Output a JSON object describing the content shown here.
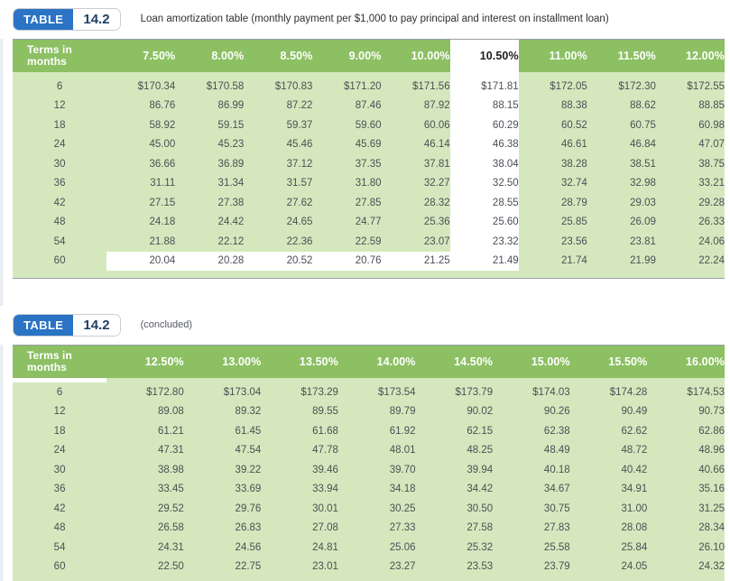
{
  "tables": [
    {
      "badge_label": "TABLE",
      "badge_number": "14.2",
      "caption": "Loan amortization table (monthly payment per $1,000 to pay principal and interest on installment loan)",
      "terms_header": "Terms in\nmonths",
      "columns": [
        "7.50%",
        "8.00%",
        "8.50%",
        "9.00%",
        "10.00%",
        "10.50%",
        "11.00%",
        "11.50%",
        "12.00%"
      ],
      "highlight_column_index": 5,
      "highlight_row_index": 9,
      "highlight_row_from_col": 0,
      "highlight_row_to_col": 5,
      "rows": [
        {
          "term": "6",
          "values": [
            "$170.34",
            "$170.58",
            "$170.83",
            "$171.20",
            "$171.56",
            "$171.81",
            "$172.05",
            "$172.30",
            "$172.55"
          ]
        },
        {
          "term": "12",
          "values": [
            "86.76",
            "86.99",
            "87.22",
            "87.46",
            "87.92",
            "88.15",
            "88.38",
            "88.62",
            "88.85"
          ]
        },
        {
          "term": "18",
          "values": [
            "58.92",
            "59.15",
            "59.37",
            "59.60",
            "60.06",
            "60.29",
            "60.52",
            "60.75",
            "60.98"
          ]
        },
        {
          "term": "24",
          "values": [
            "45.00",
            "45.23",
            "45.46",
            "45.69",
            "46.14",
            "46.38",
            "46.61",
            "46.84",
            "47.07"
          ]
        },
        {
          "term": "30",
          "values": [
            "36.66",
            "36.89",
            "37.12",
            "37.35",
            "37.81",
            "38.04",
            "38.28",
            "38.51",
            "38.75"
          ]
        },
        {
          "term": "36",
          "values": [
            "31.11",
            "31.34",
            "31.57",
            "31.80",
            "32.27",
            "32.50",
            "32.74",
            "32.98",
            "33.21"
          ]
        },
        {
          "term": "42",
          "values": [
            "27.15",
            "27.38",
            "27.62",
            "27.85",
            "28.32",
            "28.55",
            "28.79",
            "29.03",
            "29.28"
          ]
        },
        {
          "term": "48",
          "values": [
            "24.18",
            "24.42",
            "24.65",
            "24.77",
            "25.36",
            "25.60",
            "25.85",
            "26.09",
            "26.33"
          ]
        },
        {
          "term": "54",
          "values": [
            "21.88",
            "22.12",
            "22.36",
            "22.59",
            "23.07",
            "23.32",
            "23.56",
            "23.81",
            "24.06"
          ]
        },
        {
          "term": "60",
          "values": [
            "20.04",
            "20.28",
            "20.52",
            "20.76",
            "21.25",
            "21.49",
            "21.74",
            "21.99",
            "22.24"
          ]
        }
      ]
    },
    {
      "badge_label": "TABLE",
      "badge_number": "14.2",
      "caption": "(concluded)",
      "terms_header": "Terms in\nmonths",
      "columns": [
        "12.50%",
        "13.00%",
        "13.50%",
        "14.00%",
        "14.50%",
        "15.00%",
        "15.50%",
        "16.00%"
      ],
      "highlight_column_index": -1,
      "highlight_row_index": -1,
      "highlight_row_from_col": -1,
      "highlight_row_to_col": -1,
      "rows": [
        {
          "term": "6",
          "values": [
            "$172.80",
            "$173.04",
            "$173.29",
            "$173.54",
            "$173.79",
            "$174.03",
            "$174.28",
            "$174.53"
          ]
        },
        {
          "term": "12",
          "values": [
            "89.08",
            "89.32",
            "89.55",
            "89.79",
            "90.02",
            "90.26",
            "90.49",
            "90.73"
          ]
        },
        {
          "term": "18",
          "values": [
            "61.21",
            "61.45",
            "61.68",
            "61.92",
            "62.15",
            "62.38",
            "62.62",
            "62.86"
          ]
        },
        {
          "term": "24",
          "values": [
            "47.31",
            "47.54",
            "47.78",
            "48.01",
            "48.25",
            "48.49",
            "48.72",
            "48.96"
          ]
        },
        {
          "term": "30",
          "values": [
            "38.98",
            "39.22",
            "39.46",
            "39.70",
            "39.94",
            "40.18",
            "40.42",
            "40.66"
          ]
        },
        {
          "term": "36",
          "values": [
            "33.45",
            "33.69",
            "33.94",
            "34.18",
            "34.42",
            "34.67",
            "34.91",
            "35.16"
          ]
        },
        {
          "term": "42",
          "values": [
            "29.52",
            "29.76",
            "30.01",
            "30.25",
            "30.50",
            "30.75",
            "31.00",
            "31.25"
          ]
        },
        {
          "term": "48",
          "values": [
            "26.58",
            "26.83",
            "27.08",
            "27.33",
            "27.58",
            "27.83",
            "28.08",
            "28.34"
          ]
        },
        {
          "term": "54",
          "values": [
            "24.31",
            "24.56",
            "24.81",
            "25.06",
            "25.32",
            "25.58",
            "25.84",
            "26.10"
          ]
        },
        {
          "term": "60",
          "values": [
            "22.50",
            "22.75",
            "23.01",
            "23.27",
            "23.53",
            "23.79",
            "24.05",
            "24.32"
          ]
        }
      ]
    }
  ],
  "colors": {
    "header_green": "#8cc063",
    "body_green": "#d5e8bd",
    "badge_blue": "#2b73c4",
    "highlight_white": "#ffffff",
    "text_gray": "#4b4f55"
  }
}
